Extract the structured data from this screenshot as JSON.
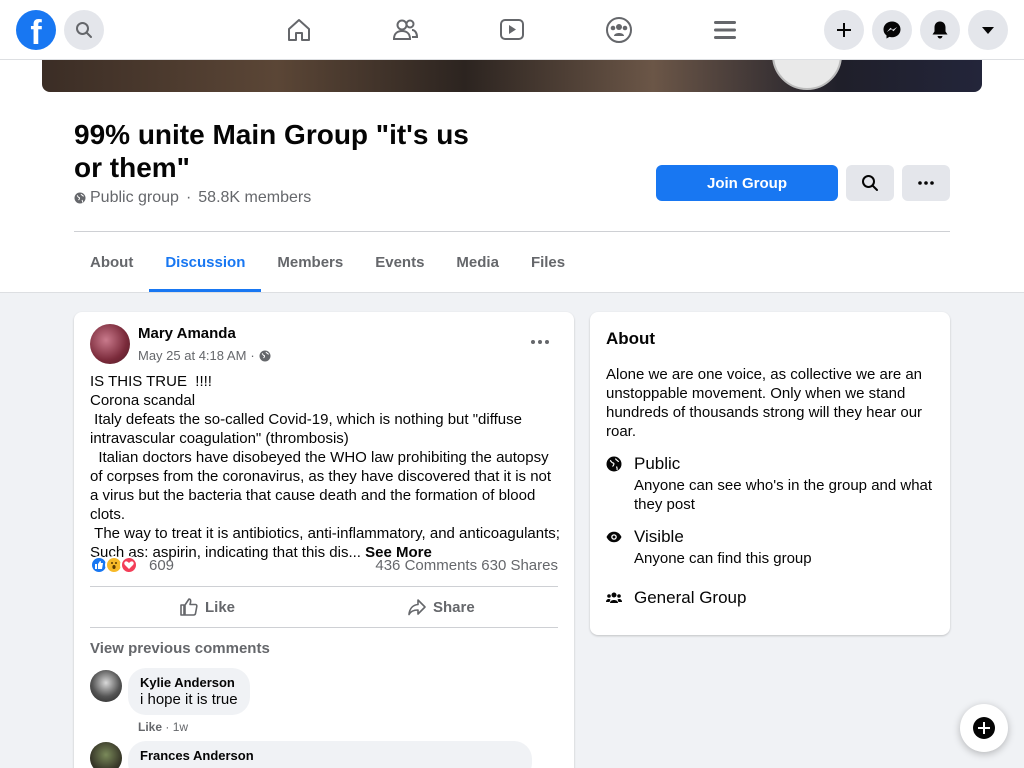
{
  "topbar": {
    "logo_letter": "f",
    "nav": [
      "home-icon",
      "friends-icon",
      "watch-icon",
      "groups-icon",
      "menu-icon"
    ],
    "right": [
      "create-icon",
      "messenger-icon",
      "notifications-icon",
      "account-caret-icon"
    ]
  },
  "group": {
    "title": "99% unite Main Group \"it's us or them\"",
    "privacy": "Public group",
    "separator": "·",
    "members": "58.8K members",
    "join_label": "Join Group",
    "tabs": [
      "About",
      "Discussion",
      "Members",
      "Events",
      "Media",
      "Files"
    ],
    "active_tab": "Discussion"
  },
  "post": {
    "author": "Mary Amanda",
    "date": "May 25 at 4:18 AM",
    "separator": "·",
    "body": "IS THIS TRUE  !!!!\nCorona scandal\n Italy defeats the so-called Covid-19, which is nothing but \"diffuse intravascular coagulation\" (thrombosis)\n  Italian doctors have disobeyed the WHO law prohibiting the autopsy of corpses from the coronavirus, as they have discovered that it is not a virus but the bacteria that cause death and the formation of blood clots.\n The way to treat it is antibiotics, anti-inflammatory, and anticoagulants; Such as: aspirin, indicating that this dis... ",
    "see_more": "See More",
    "reaction_count": "609",
    "comments": "436 Comments",
    "shares": "630 Shares",
    "like_label": "Like",
    "share_label": "Share",
    "view_previous": "View previous comments",
    "comment1": {
      "name": "Kylie Anderson",
      "text": "i hope it is true",
      "like": "Like",
      "separator": "·",
      "time": "1w"
    },
    "comment2": {
      "name": "Frances Anderson"
    }
  },
  "about": {
    "heading": "About",
    "description": "Alone we are one voice, as collective we are an unstoppable movement. Only when we stand hundreds of thousands strong will they hear our roar.",
    "public_title": "Public",
    "public_desc": "Anyone can see who's in the group and what they post",
    "visible_title": "Visible",
    "visible_desc": "Anyone can find this group",
    "type": "General Group"
  },
  "colors": {
    "brand": "#1877f2",
    "secondary_text": "#65676b",
    "background": "#f0f2f5"
  }
}
